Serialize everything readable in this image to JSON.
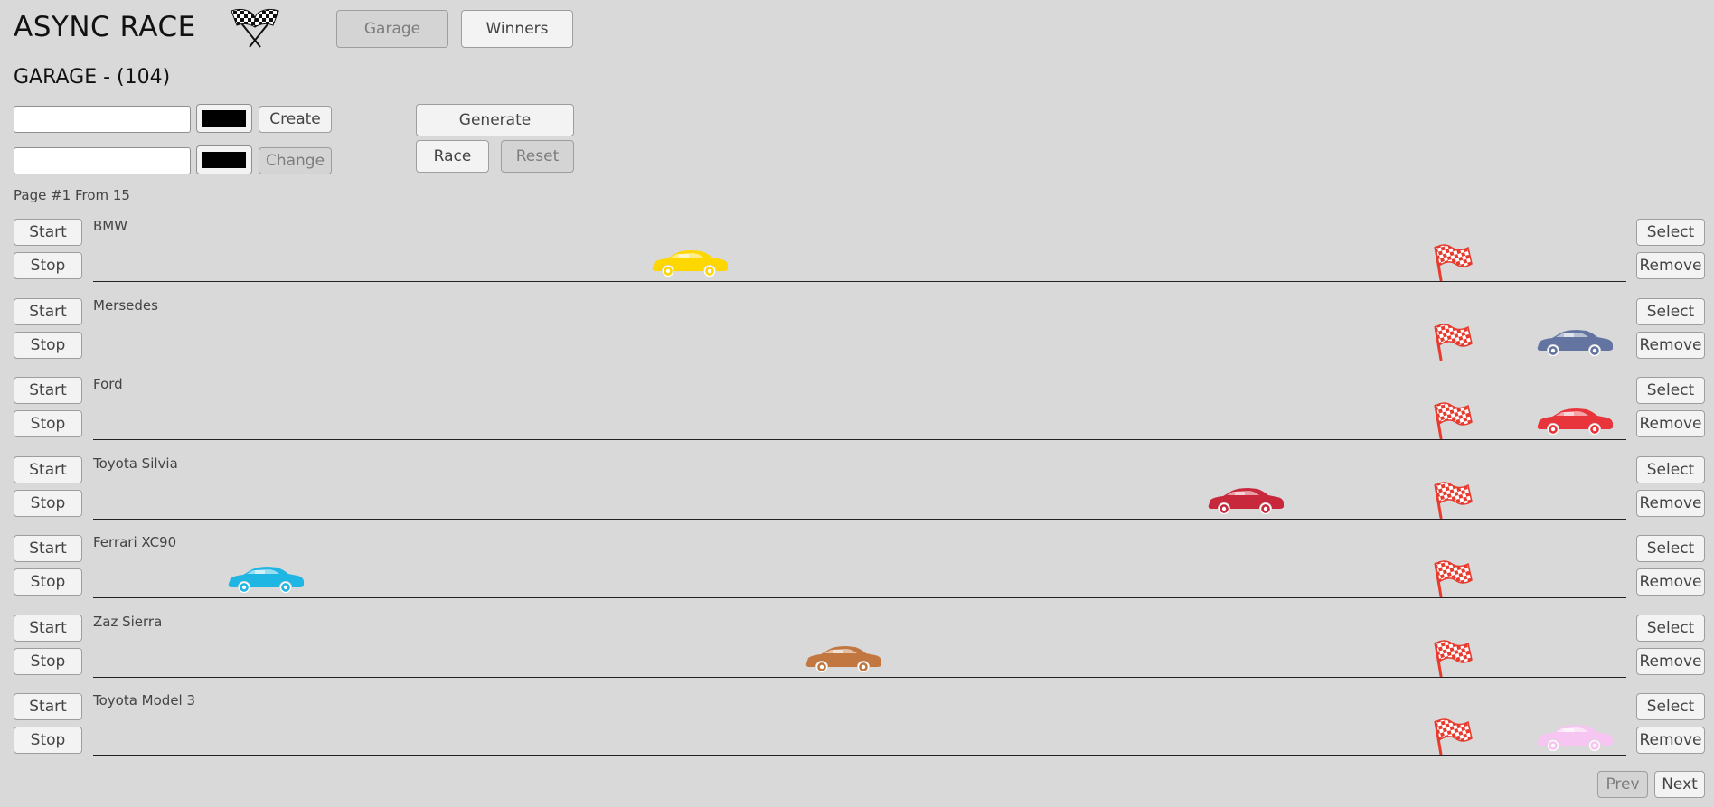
{
  "app": {
    "title": "ASYNC RACE"
  },
  "nav": {
    "garage_label": "Garage",
    "winners_label": "Winners"
  },
  "garage": {
    "heading": "GARAGE - (104)"
  },
  "create_form": {
    "name_value": "",
    "color": "#000000",
    "button_label": "Create"
  },
  "update_form": {
    "name_value": "",
    "color": "#000000",
    "button_label": "Change"
  },
  "controls": {
    "generate_label": "Generate",
    "race_label": "Race",
    "reset_label": "Reset"
  },
  "pagination": {
    "info": "Page #1 From 15",
    "prev_label": "Prev",
    "next_label": "Next"
  },
  "row_buttons": {
    "start_label": "Start",
    "stop_label": "Stop",
    "select_label": "Select",
    "remove_label": "Remove"
  },
  "cars": [
    {
      "name": "BMW",
      "color": "#ffd700",
      "progress": 0.38
    },
    {
      "name": "Mersedes",
      "color": "#6374a0",
      "progress": 0.985
    },
    {
      "name": "Ford",
      "color": "#e8343b",
      "progress": 0.985
    },
    {
      "name": "Toyota Silvia",
      "color": "#c8283c",
      "progress": 0.76
    },
    {
      "name": "Ferrari XC90",
      "color": "#1fb6e4",
      "progress": 0.09
    },
    {
      "name": "Zaz Sierra",
      "color": "#c27640",
      "progress": 0.485
    },
    {
      "name": "Toyota Model 3",
      "color": "#f6c5f1",
      "progress": 0.985
    }
  ],
  "colors": {
    "background": "#d9d9d9",
    "flag_red": "#e63b2e"
  },
  "icons": {
    "logo": "checkered-flags-icon",
    "finish": "finish-flag-icon",
    "car": "car-icon"
  }
}
